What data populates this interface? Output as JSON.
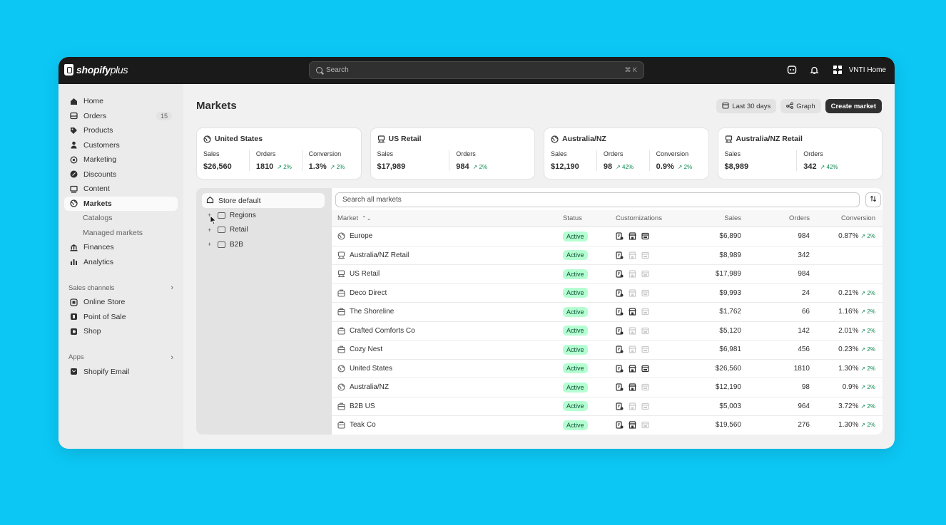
{
  "topbar": {
    "brand": "shopify",
    "brand_suffix": "plus",
    "search_placeholder": "Search",
    "search_shortcut": "⌘ K",
    "store_name": "VNTI Home"
  },
  "sidebar": {
    "items": [
      {
        "label": "Home",
        "icon": "home-icon"
      },
      {
        "label": "Orders",
        "icon": "inbox-icon",
        "count": "15"
      },
      {
        "label": "Products",
        "icon": "tag-icon"
      },
      {
        "label": "Customers",
        "icon": "person-icon"
      },
      {
        "label": "Marketing",
        "icon": "target-icon"
      },
      {
        "label": "Discounts",
        "icon": "discount-icon"
      },
      {
        "label": "Content",
        "icon": "content-icon"
      },
      {
        "label": "Markets",
        "icon": "globe-icon"
      },
      {
        "label": "Catalogs"
      },
      {
        "label": "Managed markets"
      },
      {
        "label": "Finances",
        "icon": "bank-icon"
      },
      {
        "label": "Analytics",
        "icon": "bar-chart-icon"
      }
    ],
    "sales_channels_title": "Sales channels",
    "sales_channels": [
      {
        "label": "Online Store",
        "icon": "storefront-icon"
      },
      {
        "label": "Point of Sale",
        "icon": "pos-icon"
      },
      {
        "label": "Shop",
        "icon": "shop-icon"
      }
    ],
    "apps_title": "Apps",
    "apps": [
      {
        "label": "Shopify Email",
        "icon": "email-icon"
      }
    ]
  },
  "main": {
    "title": "Markets",
    "actions": {
      "date_range": "Last 30 days",
      "graph": "Graph",
      "create": "Create market"
    },
    "cards": [
      {
        "title": "United States",
        "icon": "globe-icon",
        "metrics": [
          {
            "label": "Sales",
            "value": "$26,560",
            "delta": ""
          },
          {
            "label": "Orders",
            "value": "1810",
            "delta": "↗ 2%"
          },
          {
            "label": "Conversion",
            "value": "1.3%",
            "delta": "↗ 2%"
          }
        ]
      },
      {
        "title": "US Retail",
        "icon": "pos-icon",
        "metrics": [
          {
            "label": "Sales",
            "value": "$17,989",
            "delta": ""
          },
          {
            "label": "Orders",
            "value": "984",
            "delta": "↗ 2%"
          }
        ]
      },
      {
        "title": "Australia/NZ",
        "icon": "globe-icon",
        "metrics": [
          {
            "label": "Sales",
            "value": "$12,190",
            "delta": ""
          },
          {
            "label": "Orders",
            "value": "98",
            "delta": "↗ 42%"
          },
          {
            "label": "Conversion",
            "value": "0.9%",
            "delta": "↗ 2%"
          }
        ]
      },
      {
        "title": "Australia/NZ Retail",
        "icon": "pos-icon",
        "metrics": [
          {
            "label": "Sales",
            "value": "$8,989",
            "delta": ""
          },
          {
            "label": "Orders",
            "value": "342",
            "delta": "↗ 42%"
          }
        ]
      }
    ],
    "tree": {
      "root": "Store default",
      "items": [
        {
          "label": "Regions"
        },
        {
          "label": "Retail"
        },
        {
          "label": "B2B"
        }
      ]
    },
    "table": {
      "search_placeholder": "Search all markets",
      "headers": {
        "market": "Market",
        "status": "Status",
        "customizations": "Customizations",
        "sales": "Sales",
        "orders": "Orders",
        "conversion": "Conversion"
      },
      "rows": [
        {
          "market": "Europe",
          "icon": "globe-icon",
          "status": "Active",
          "cust": [
            1,
            1,
            1
          ],
          "sales": "$6,890",
          "orders": "984",
          "conv": "0.87%",
          "delta": "↗ 2%"
        },
        {
          "market": "Australia/NZ Retail",
          "icon": "pos-icon",
          "status": "Active",
          "cust": [
            1,
            0,
            0
          ],
          "sales": "$8,989",
          "orders": "342",
          "conv": "",
          "delta": ""
        },
        {
          "market": "US Retail",
          "icon": "pos-icon",
          "status": "Active",
          "cust": [
            1,
            0,
            0
          ],
          "sales": "$17,989",
          "orders": "984",
          "conv": "",
          "delta": ""
        },
        {
          "market": "Deco Direct",
          "icon": "b2b-icon",
          "status": "Active",
          "cust": [
            1,
            0,
            0
          ],
          "sales": "$9,993",
          "orders": "24",
          "conv": "0.21%",
          "delta": "↗ 2%"
        },
        {
          "market": "The Shoreline",
          "icon": "b2b-icon",
          "status": "Active",
          "cust": [
            1,
            1,
            0
          ],
          "sales": "$1,762",
          "orders": "66",
          "conv": "1.16%",
          "delta": "↗ 2%"
        },
        {
          "market": "Crafted Comforts Co",
          "icon": "b2b-icon",
          "status": "Active",
          "cust": [
            1,
            0,
            0
          ],
          "sales": "$5,120",
          "orders": "142",
          "conv": "2.01%",
          "delta": "↗ 2%"
        },
        {
          "market": "Cozy Nest",
          "icon": "b2b-icon",
          "status": "Active",
          "cust": [
            1,
            0,
            0
          ],
          "sales": "$6,981",
          "orders": "456",
          "conv": "0.23%",
          "delta": "↗ 2%"
        },
        {
          "market": "United States",
          "icon": "globe-icon",
          "status": "Active",
          "cust": [
            1,
            1,
            1
          ],
          "sales": "$26,560",
          "orders": "1810",
          "conv": "1.30%",
          "delta": "↗ 2%"
        },
        {
          "market": "Australia/NZ",
          "icon": "globe-icon",
          "status": "Active",
          "cust": [
            1,
            1,
            0
          ],
          "sales": "$12,190",
          "orders": "98",
          "conv": "0.9%",
          "delta": "↗ 2%"
        },
        {
          "market": "B2B US",
          "icon": "b2b-icon",
          "status": "Active",
          "cust": [
            1,
            0,
            0
          ],
          "sales": "$5,003",
          "orders": "964",
          "conv": "3.72%",
          "delta": "↗ 2%"
        },
        {
          "market": "Teak Co",
          "icon": "b2b-icon",
          "status": "Active",
          "cust": [
            1,
            1,
            0
          ],
          "sales": "$19,560",
          "orders": "276",
          "conv": "1.30%",
          "delta": "↗ 2%"
        }
      ]
    }
  },
  "colors": {
    "background": "#0cc7f4",
    "topbar": "#1a1a1a",
    "active_badge": "#b4fed2",
    "delta_green": "#0c8a4f"
  }
}
